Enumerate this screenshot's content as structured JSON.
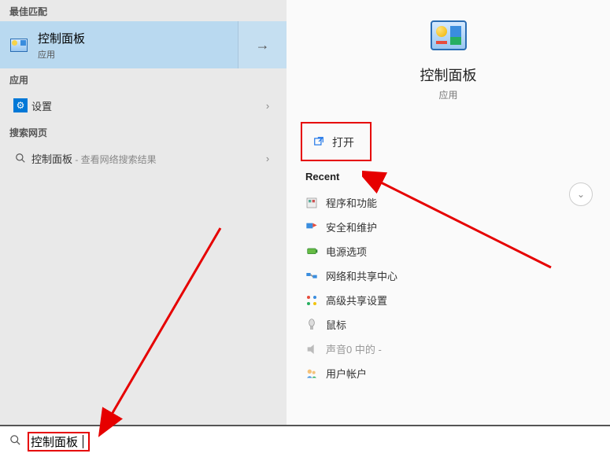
{
  "left": {
    "best_match_header": "最佳匹配",
    "best_match": {
      "title": "控制面板",
      "subtitle": "应用"
    },
    "apps_header": "应用",
    "settings_label": "设置",
    "web_header": "搜索网页",
    "web_item": {
      "prefix": "控制面板",
      "suffix": " - 查看网络搜索结果"
    }
  },
  "right": {
    "title": "控制面板",
    "subtitle": "应用",
    "open_label": "打开",
    "recent_header": "Recent",
    "recent": [
      {
        "label": "程序和功能",
        "dimmed": false
      },
      {
        "label": "安全和维护",
        "dimmed": false
      },
      {
        "label": "电源选项",
        "dimmed": false
      },
      {
        "label": "网络和共享中心",
        "dimmed": false
      },
      {
        "label": "高级共享设置",
        "dimmed": false
      },
      {
        "label": "鼠标",
        "dimmed": false
      },
      {
        "label": "声音0 中的 -",
        "dimmed": true
      },
      {
        "label": "用户帐户",
        "dimmed": false
      }
    ]
  },
  "search": {
    "value": "控制面板"
  },
  "annotations": {
    "open_highlighted": true,
    "search_highlighted": true
  }
}
